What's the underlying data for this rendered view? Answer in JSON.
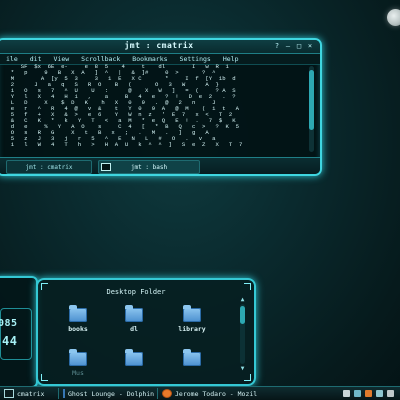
{
  "terminal": {
    "title": "jmt : cmatrix",
    "menu": [
      "ile",
      "dit",
      "View",
      "Scrollback",
      "Bookmarks",
      "Settings",
      "Help"
    ],
    "matrix_lines": [
      "     SF  $x  6E  e-     e  8  5    4     t    dl        I   w  R  1",
      "  *   p     9   B   X  A   ]  ^   |   &  ]#     0  >       ?  ^",
      "  M        A  [y  5  3     3   1  E   X C       *     I  f  [Y  1b  d",
      "  2      J   a   q   S   R  O    B   (       O   3   W      A  }",
      "  i   O   s   7   ^  U    U   :      @    X   W   ]   =  (     ? A  S",
      "  Y   l   X   4   H  i   ,    a     B   4   e   ?  !   D  e  2   .  ?",
      "  L   D     X    $  D   K    h   X   0   9   .  @   2   n     J",
      "  e   r   ^   R   4  @   v  &    t   Y  0   9  A   @  M    (  i  t   A",
      "  5   f   +   X   &  >   e  6    Y   W  n  z   '  E  7   x  <   T  2",
      "  &   C   K   *   k   Y   T   <   a  M   *  e  Q   E  !  .   7  $   K",
      "  d   e     %   Y   A  O    s     C  4   [   *  B   Q   c  >   ?  K  5",
      "  O   s   R   G     X   t   B   x   ;   .   M   .   ]   g   A",
      "  5   z   J   3   j   r   5   ^   E   N   L   #   O   .   v   a",
      "  i   l   W   4   T   h   >   H  A  U   k  ^  ^  ]   S  e  Z   X   T  7"
    ],
    "tabs": [
      "jmt : cmatrix",
      "jmt : bash"
    ]
  },
  "clock": {
    "line1": "085",
    "line2": "44"
  },
  "desktop_folder": {
    "title": "Desktop Folder",
    "items": [
      "books",
      "dl",
      "library",
      "Mus",
      "",
      ""
    ]
  },
  "taskbar": {
    "tasks": [
      "cmatrix",
      "Ghost Lounge - Dolphin",
      "Jerome Todaro - Mozil"
    ]
  },
  "colors": {
    "accent": "#35c8d4",
    "background": "#0a2a2e"
  }
}
